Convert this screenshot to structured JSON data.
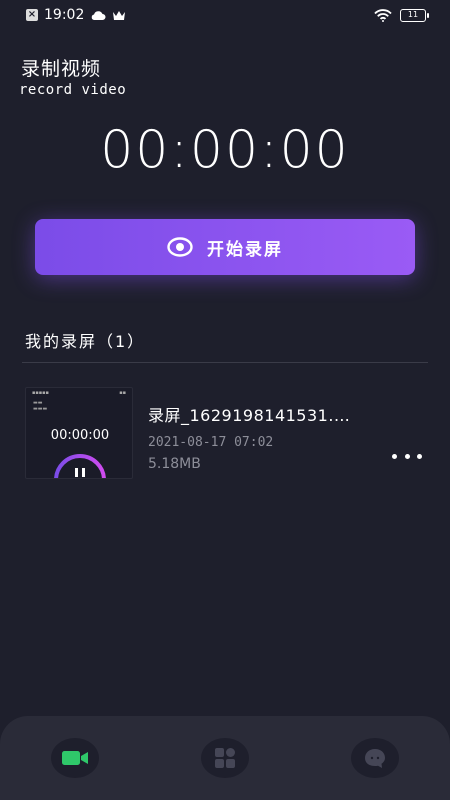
{
  "status_bar": {
    "time": "19:02",
    "battery": "11"
  },
  "header": {
    "title": "录制视频",
    "subtitle": "record video"
  },
  "timer": "00:00:00",
  "record_button": {
    "label": "开始录屏",
    "icon": "eye-icon"
  },
  "recordings": {
    "title": "我的录屏（1）",
    "items": [
      {
        "name": "录屏_1629198141531.…",
        "date": "2021-08-17 07:02",
        "size": "5.18MB",
        "thumb_time": "00:00:00"
      }
    ]
  },
  "bottom_nav": {
    "items": [
      {
        "icon": "video-camera-icon",
        "active": true
      },
      {
        "icon": "apps-grid-icon",
        "active": false
      },
      {
        "icon": "chat-face-icon",
        "active": false
      }
    ]
  },
  "colors": {
    "background": "#1e1f2c",
    "accent_start": "#7b4ce8",
    "accent_end": "#9a5bf5",
    "nav_active": "#2fc86a",
    "nav_bg": "#2a2b38"
  }
}
